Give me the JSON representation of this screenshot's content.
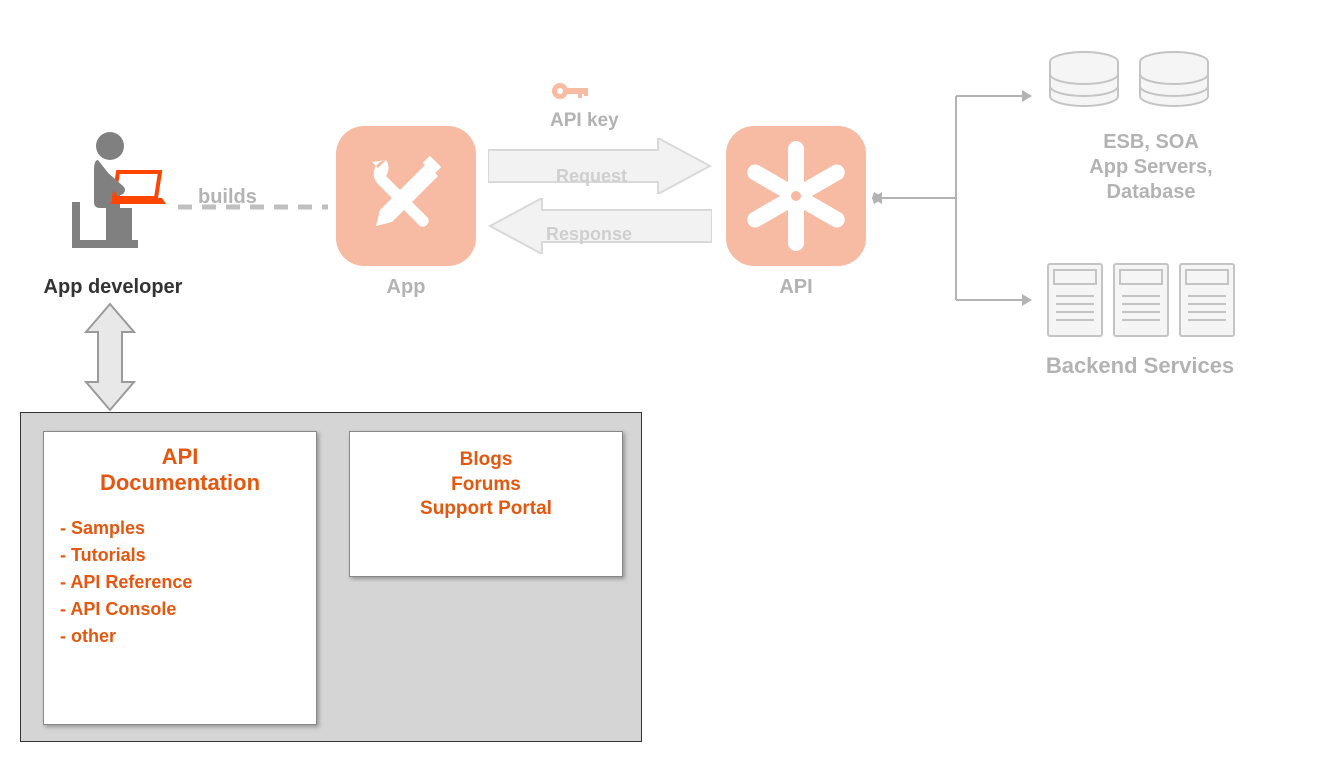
{
  "developer": {
    "label": "App developer"
  },
  "builds": {
    "label": "builds"
  },
  "app": {
    "label": "App"
  },
  "api": {
    "label": "API"
  },
  "apiKey": {
    "label": "API key"
  },
  "request": {
    "label": "Request"
  },
  "response": {
    "label": "Response"
  },
  "backend": {
    "top": "ESB, SOA\nApp Servers,\nDatabase",
    "bottomLabel": "Backend Services"
  },
  "docPanel": {
    "title": "API\nDocumentation",
    "items": [
      "- Samples",
      "- Tutorials",
      "- API Reference",
      "- API Console",
      "- other"
    ]
  },
  "communityPanel": {
    "items": [
      "Blogs",
      "Forums",
      "Support Portal"
    ]
  }
}
